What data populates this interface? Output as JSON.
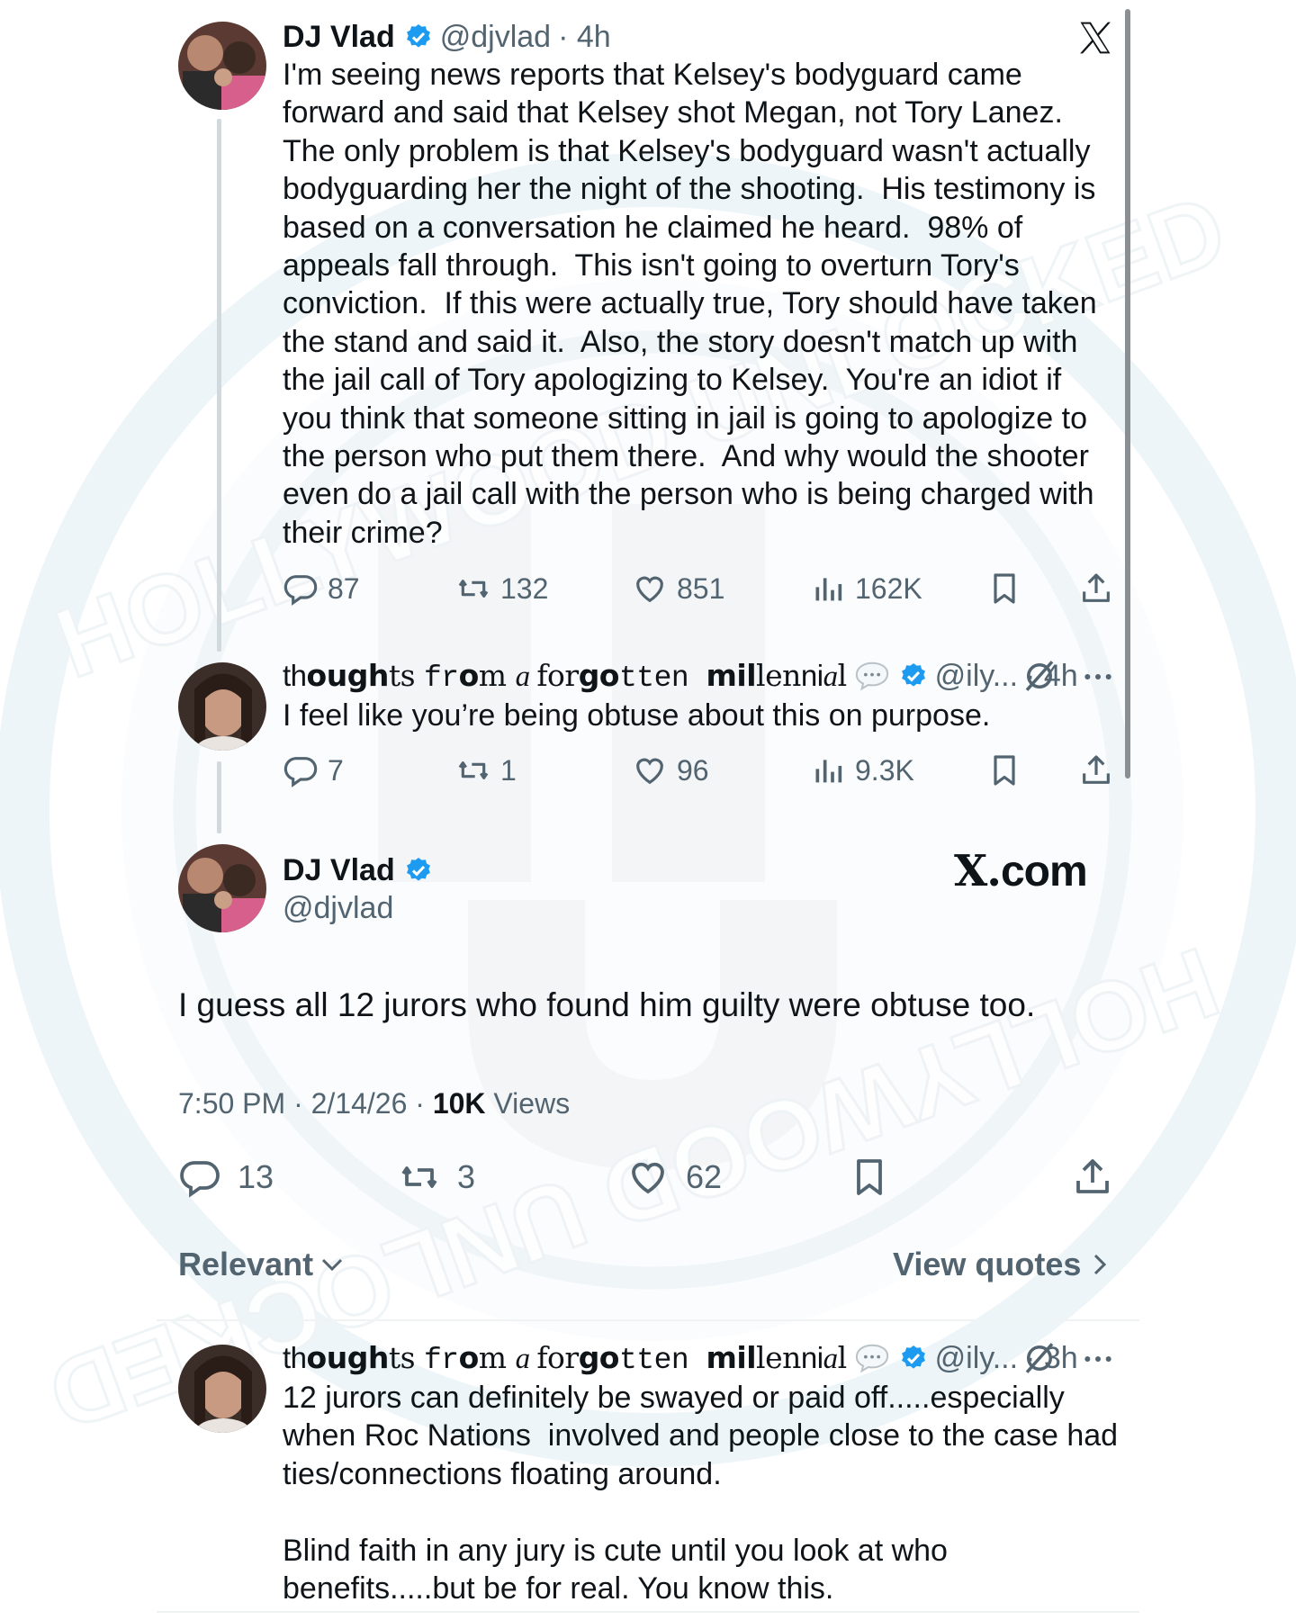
{
  "app": {
    "logo_icon": "x-logo-icon",
    "site_label": "com",
    "site_label_prefix": "X."
  },
  "colors": {
    "verified_blue": "#1d9bf0",
    "text": "#0f1419",
    "secondary": "#536471",
    "line": "#cfd9de"
  },
  "tweet1": {
    "name": "DJ Vlad",
    "handle": "@djvlad",
    "time": "· 4h",
    "text": "I'm seeing news reports that Kelsey's bodyguard came\nforward and said that Kelsey shot Megan, not Tory Lanez.\nThe only problem is that Kelsey's bodyguard wasn't actually\nbodyguarding her the night of the shooting.  His testimony is\nbased on a conversation he claimed he heard.  98% of\nappeals fall through.  This isn't going to overturn Tory's\nconviction.  If this were actually true, Tory should have taken\nthe stand and said it.  Also, the story doesn't match up with\nthe jail call of Tory apologizing to Kelsey.  You're an idiot if\nyou think that someone sitting in jail is going to apologize to\nthe person who put them there.  And why would the shooter\neven do a jail call with the person who is being charged with\ntheir crime?",
    "replies": "87",
    "reposts": "132",
    "likes": "851",
    "views": "162K"
  },
  "reply1": {
    "name_parts": [
      "th",
      "ough",
      "ts ",
      "fr",
      "o",
      "m ",
      "a ",
      "for",
      "go",
      "tten ",
      "mil",
      "len",
      "ni",
      "a",
      "l"
    ],
    "handle": "@ily...",
    "time": "· 4h",
    "text": "I feel like you’re being obtuse about this on purpose.",
    "replies": "7",
    "reposts": "1",
    "likes": "96",
    "views": "9.3K"
  },
  "main_tweet": {
    "name": "DJ Vlad",
    "handle": "@djvlad",
    "text": "I guess all 12 jurors who found him guilty were obtuse too.",
    "timestamp": "7:50 PM · 2/14/26 · ",
    "views_count": "10K",
    "views_label": " Views",
    "replies": "13",
    "reposts": "3",
    "likes": "62"
  },
  "tabs": {
    "sort_label": "Relevant",
    "quotes_label": "View quotes"
  },
  "reply2": {
    "name_parts": [
      "th",
      "ough",
      "ts ",
      "fr",
      "o",
      "m ",
      "a ",
      "for",
      "go",
      "tten ",
      "mil",
      "len",
      "ni",
      "a",
      "l"
    ],
    "handle": "@ily...",
    "time": "· 3h",
    "text": "12 jurors can definitely be swayed or paid off.....especially\nwhen Roc Nations  involved and people close to the case had\nties/connections floating around.\n\nBlind faith in any jury is cute until you look at who\nbenefits.....but be for real. You know this."
  },
  "watermark": {
    "text_top": "HOLLYWOOD UNLOCKED",
    "text_bottom": "HOLLYWOOD UNLOCKED"
  }
}
